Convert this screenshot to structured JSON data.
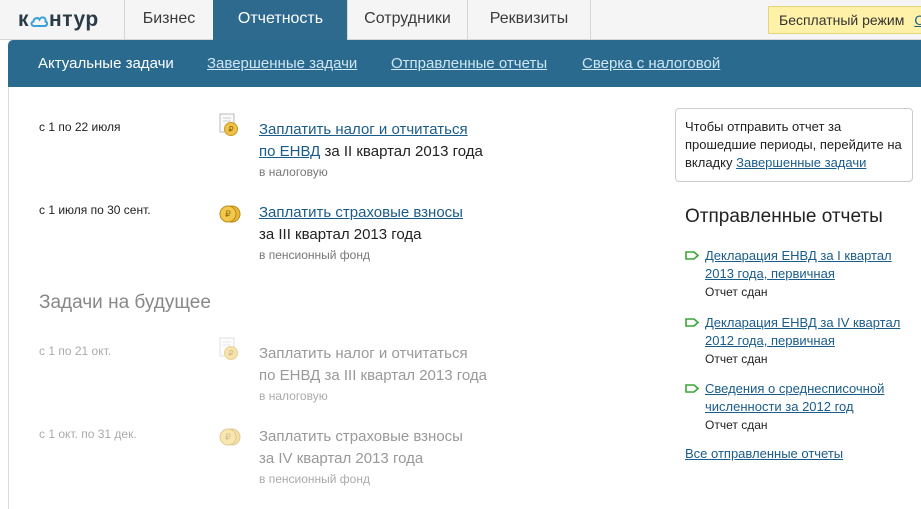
{
  "logo": {
    "text_left": "к",
    "text_right": "нтур"
  },
  "top_tabs": [
    {
      "label": "Бизнес"
    },
    {
      "label": "Отчетность"
    },
    {
      "label": "Сотрудники"
    },
    {
      "label": "Реквизиты"
    }
  ],
  "free_badge": {
    "label": "Бесплатный режим",
    "more": "Оп"
  },
  "subnav": {
    "current": "Актуальные задачи",
    "completed": "Завершенные задачи",
    "sent": "Отправленные отчеты",
    "reconcile": "Сверка с налоговой"
  },
  "tasks": [
    {
      "date": "с 1 по 22 июля",
      "link": "Заплатить налог и отчитаться по ЕНВД",
      "link_line1": "Заплатить налог и отчитаться",
      "link_line2": "по ЕНВД",
      "rest": "за II квартал 2013 года",
      "destination": "в налоговую",
      "icon": "tax-document-icon"
    },
    {
      "date": "с 1 июля по 30 сент.",
      "link": "Заплатить страховые взносы",
      "rest": "за III квартал 2013 года",
      "destination": "в пенсионный фонд",
      "icon": "coins-icon"
    }
  ],
  "future": {
    "title": "Задачи на будущее",
    "tasks": [
      {
        "date": "с 1 по 21 окт.",
        "line1": "Заплатить налог и отчитаться",
        "line2": "по ЕНВД за III квартал 2013 года",
        "destination": "в налоговую",
        "icon": "tax-document-icon"
      },
      {
        "date": "с 1 окт. по 31 дек.",
        "line1": "Заплатить страховые взносы",
        "line2": "за IV квартал 2013 года",
        "destination": "в пенсионный фонд",
        "icon": "coins-icon"
      }
    ]
  },
  "notice": {
    "text": "Чтобы отправить отчет за прошедшие периоды, перейдите на вкладку",
    "link": "Завершенные задачи"
  },
  "sent_reports": {
    "title": "Отправленные отчеты",
    "items": [
      {
        "title": "Декларация ЕНВД за I квартал 2013 года, первичная",
        "status": "Отчет сдан"
      },
      {
        "title": "Декларация ЕНВД за IV квартал 2012 года, первичная",
        "status": "Отчет сдан"
      },
      {
        "title": "Сведения о среднесписочной численности за 2012 год",
        "status": "Отчет сдан"
      }
    ],
    "all_link": "Все отправленные отчеты"
  },
  "colors": {
    "accent": "#2b6a8f",
    "link": "#1a5c8a",
    "badge": "#fff2a8",
    "flag": "#3aa635"
  }
}
